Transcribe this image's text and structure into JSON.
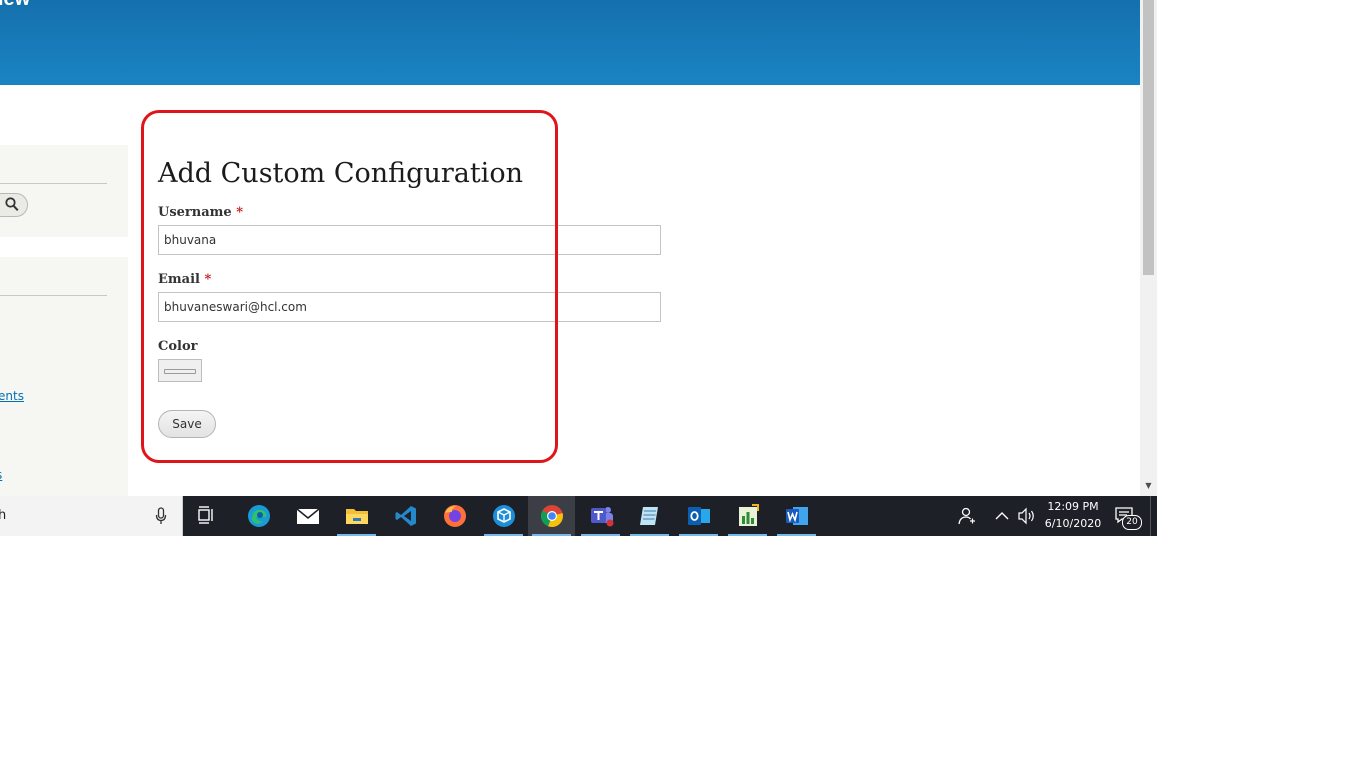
{
  "site": {
    "name": "iew"
  },
  "sidebar": {
    "link_1": "ents",
    "link_2": "s"
  },
  "form": {
    "title": "Add Custom Configuration",
    "required_marker": "*",
    "username": {
      "label": "Username",
      "value": "bhuvana"
    },
    "email": {
      "label": "Email",
      "value": "bhuvaneswari@hcl.com"
    },
    "color": {
      "label": "Color"
    },
    "save_label": "Save"
  },
  "taskbar": {
    "search_text": "h",
    "apps": [
      "task-view",
      "edge",
      "mail",
      "file-explorer",
      "vs-code",
      "firefox",
      "package-app",
      "chrome",
      "teams",
      "notepad",
      "outlook",
      "project",
      "word"
    ],
    "clock": {
      "time": "12:09 PM",
      "date": "6/10/2020"
    },
    "notifications": "20"
  },
  "colors": {
    "header": "#1a7bbd",
    "highlight": "#e0151c",
    "taskbar": "#1d2027",
    "link": "#0071b3"
  }
}
